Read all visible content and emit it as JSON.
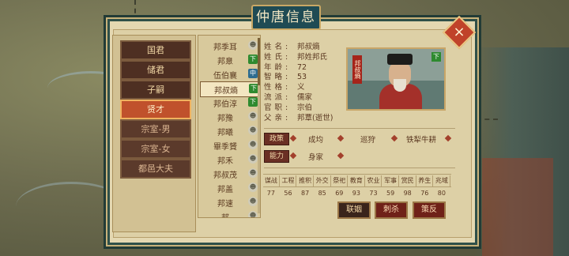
{
  "window": {
    "title": "仲唐信息",
    "close_label": "×"
  },
  "categories": [
    {
      "label": "国君",
      "active": false
    },
    {
      "label": "储君",
      "active": false
    },
    {
      "label": "子嗣",
      "active": false
    },
    {
      "label": "贤才",
      "active": true
    },
    {
      "label": "宗室-男",
      "active": false
    },
    {
      "label": "宗室-女",
      "active": false
    },
    {
      "label": "都邑大夫",
      "active": false
    }
  ],
  "people": [
    {
      "name": "邦季耳",
      "badge": "face"
    },
    {
      "name": "邦臮",
      "badge": "下"
    },
    {
      "name": "伍伯襄",
      "badge": "中"
    },
    {
      "name": "邦叔熵",
      "badge": "下"
    },
    {
      "name": "邦伯淳",
      "badge": "下"
    },
    {
      "name": "邦豫",
      "badge": "face"
    },
    {
      "name": "邦曦",
      "badge": "face"
    },
    {
      "name": "畢季贇",
      "badge": "face"
    },
    {
      "name": "邦禾",
      "badge": "face"
    },
    {
      "name": "邦叔茂",
      "badge": "face"
    },
    {
      "name": "邦盖",
      "badge": "face"
    },
    {
      "name": "邦速",
      "badge": "face"
    },
    {
      "name": "邦",
      "badge": "face"
    }
  ],
  "selected_index": 3,
  "info": [
    {
      "label": "姓名:",
      "value": "邦叔熵"
    },
    {
      "label": "姓氏:",
      "value": "邦姓邦氏"
    },
    {
      "label": "年龄:",
      "value": "72"
    },
    {
      "label": "智略:",
      "value": "53"
    },
    {
      "label": "性格:",
      "value": "义"
    },
    {
      "label": "流派:",
      "value": "儒家"
    },
    {
      "label": "官职:",
      "value": "宗伯"
    },
    {
      "label": "父亲:",
      "value": "邦覃(逝世)"
    }
  ],
  "portrait": {
    "seal_text": "邦叔熵",
    "badge": "下"
  },
  "policy": {
    "tag": "政策",
    "items": [
      "成均",
      "巡狩",
      "铁犁牛耕"
    ]
  },
  "ability": {
    "tag": "能力",
    "items": [
      "身家"
    ]
  },
  "stats": {
    "headers": [
      "谋战",
      "工程",
      "推积",
      "外交",
      "祭祀",
      "教育",
      "农业",
      "军事",
      "赏民",
      "养生",
      "兆域"
    ],
    "values": [
      "77",
      "56",
      "87",
      "85",
      "69",
      "93",
      "73",
      "59",
      "98",
      "76",
      "80"
    ]
  },
  "actions": [
    {
      "label": "联姻",
      "style": "dark"
    },
    {
      "label": "刺杀",
      "style": "red"
    },
    {
      "label": "策反",
      "style": "red"
    }
  ],
  "badge_icons": {
    "face": "☻"
  }
}
